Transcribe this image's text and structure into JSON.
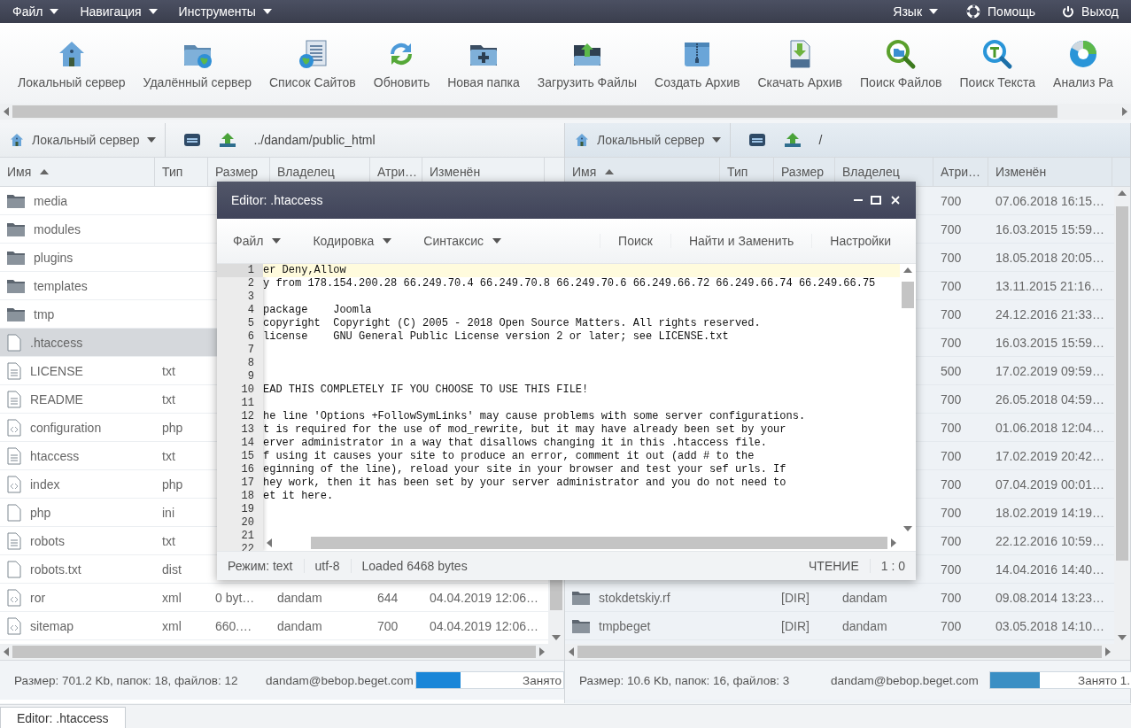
{
  "menubar": {
    "left": [
      {
        "label": "Файл"
      },
      {
        "label": "Навигация"
      },
      {
        "label": "Инструменты"
      }
    ],
    "language": {
      "label": "Язык"
    },
    "help": {
      "label": "Помощь"
    },
    "logout": {
      "label": "Выход"
    }
  },
  "toolbar": [
    {
      "label": "Локальный сервер"
    },
    {
      "label": "Удалённый сервер"
    },
    {
      "label": "Список Сайтов"
    },
    {
      "label": "Обновить"
    },
    {
      "label": "Новая папка"
    },
    {
      "label": "Загрузить Файлы"
    },
    {
      "label": "Создать Архив"
    },
    {
      "label": "Скачать Архив"
    },
    {
      "label": "Поиск Файлов"
    },
    {
      "label": "Поиск Текста"
    },
    {
      "label": "Анализ Ра"
    }
  ],
  "panels": [
    {
      "active": true,
      "server": "Локальный сервер",
      "path": "../dandam/public_html",
      "columns": [
        "Имя",
        "Тип",
        "Размер",
        "Владелец",
        "Атри…",
        "Изменён"
      ],
      "rows": [
        {
          "name": "media",
          "kind": "folder",
          "selected": false
        },
        {
          "name": "modules",
          "kind": "folder",
          "selected": false
        },
        {
          "name": "plugins",
          "kind": "folder",
          "selected": false
        },
        {
          "name": "templates",
          "kind": "folder",
          "selected": false
        },
        {
          "name": "tmp",
          "kind": "folder",
          "selected": false
        },
        {
          "name": ".htaccess",
          "kind": "blank",
          "selected": true
        },
        {
          "name": "LICENSE",
          "kind": "text",
          "type": "txt",
          "selected": false
        },
        {
          "name": "README",
          "kind": "text",
          "type": "txt",
          "selected": false
        },
        {
          "name": "configuration",
          "kind": "code",
          "type": "php",
          "selected": false
        },
        {
          "name": "htaccess",
          "kind": "text",
          "type": "txt",
          "selected": false
        },
        {
          "name": "index",
          "kind": "code",
          "type": "php",
          "selected": false
        },
        {
          "name": "php",
          "kind": "blank",
          "type": "ini",
          "selected": false
        },
        {
          "name": "robots",
          "kind": "text",
          "type": "txt",
          "selected": false
        },
        {
          "name": "robots.txt",
          "kind": "blank",
          "type": "dist",
          "selected": false
        },
        {
          "name": "ror",
          "kind": "code",
          "type": "xml",
          "size": "0 byt…",
          "owner": "dandam",
          "attributes": "644",
          "modified": "04.04.2019 12:06…",
          "selected": false
        },
        {
          "name": "sitemap",
          "kind": "code",
          "type": "xml",
          "size": "660.…",
          "owner": "dandam",
          "attributes": "700",
          "modified": "04.04.2019 12:06…",
          "selected": false
        }
      ],
      "status": "Размер: 701.2 Kb, папок: 18, файлов: 12",
      "account": "dandam@bebop.beget.com",
      "usage": {
        "label": "Занято",
        "level": 0.3
      }
    },
    {
      "active": false,
      "server": "Локальный сервер",
      "path": "/",
      "columns": [
        "Имя",
        "Тип",
        "Размер",
        "Владелец",
        "Атри…",
        "Изменён"
      ],
      "rows": [
        {
          "attributes": "700",
          "modified": "07.06.2018 16:15…",
          "selected": false
        },
        {
          "attributes": "700",
          "modified": "16.03.2015 15:59…",
          "selected": false
        },
        {
          "attributes": "700",
          "modified": "18.05.2018 20:05…",
          "selected": false
        },
        {
          "attributes": "700",
          "modified": "13.11.2015 21:16…",
          "selected": false
        },
        {
          "attributes": "700",
          "modified": "24.12.2016 21:33…",
          "selected": false
        },
        {
          "attributes": "700",
          "modified": "16.03.2015 15:59…",
          "selected": false
        },
        {
          "attributes": "500",
          "modified": "17.02.2019 09:59…",
          "selected": false
        },
        {
          "attributes": "700",
          "modified": "26.05.2018 04:59…",
          "selected": false
        },
        {
          "attributes": "700",
          "modified": "01.06.2018 12:04…",
          "selected": false
        },
        {
          "attributes": "700",
          "modified": "17.02.2019 20:42…",
          "selected": false
        },
        {
          "attributes": "700",
          "modified": "07.04.2019 00:01…",
          "selected": false
        },
        {
          "attributes": "700",
          "modified": "18.02.2019 14:19…",
          "selected": false
        },
        {
          "attributes": "700",
          "modified": "22.12.2016 10:59…",
          "selected": false
        },
        {
          "attributes": "700",
          "modified": "14.04.2016 14:40…",
          "selected": false
        },
        {
          "name": "stokdetskiy.rf",
          "kind": "folder",
          "size": "[DIR]",
          "owner": "dandam",
          "attributes": "700",
          "modified": "09.08.2014 13:23…",
          "selected": false
        },
        {
          "name": "tmpbeget",
          "kind": "folder",
          "size": "[DIR]",
          "owner": "dandam",
          "attributes": "700",
          "modified": "03.05.2018 14:10…",
          "selected": false
        }
      ],
      "status": "Размер: 10.6 Kb, папок: 16, файлов: 3",
      "account": "dandam@bebop.beget.com",
      "usage": {
        "label": "Занято 1.",
        "level": 0.35
      }
    }
  ],
  "editor": {
    "title": "Editor: .htaccess",
    "menus": [
      {
        "label": "Файл"
      },
      {
        "label": "Кодировка"
      },
      {
        "label": "Синтаксис"
      }
    ],
    "actions": [
      {
        "label": "Поиск"
      },
      {
        "label": "Найти и Заменить"
      },
      {
        "label": "Настройки"
      }
    ],
    "lines": [
      {
        "number": "1",
        "text": "er Deny,Allow",
        "current": true
      },
      {
        "number": "2",
        "text": "y from 178.154.200.28 66.249.70.4 66.249.70.8 66.249.70.6 66.249.66.72 66.249.66.74 66.249.66.75",
        "current": false
      },
      {
        "number": "3",
        "current": false
      },
      {
        "number": "4",
        "text": "package    Joomla",
        "current": false
      },
      {
        "number": "5",
        "text": "copyright  Copyright (C) 2005 - 2018 Open Source Matters. All rights reserved.",
        "current": false
      },
      {
        "number": "6",
        "text": "license    GNU General Public License version 2 or later; see LICENSE.txt",
        "current": false
      },
      {
        "number": "7",
        "current": false
      },
      {
        "number": "8",
        "current": false
      },
      {
        "number": "9",
        "current": false
      },
      {
        "number": "10",
        "text": "EAD THIS COMPLETELY IF YOU CHOOSE TO USE THIS FILE!",
        "current": false
      },
      {
        "number": "11",
        "current": false
      },
      {
        "number": "12",
        "text": "he line 'Options +FollowSymLinks' may cause problems with some server configurations.",
        "current": false
      },
      {
        "number": "13",
        "text": "t is required for the use of mod_rewrite, but it may have already been set by your",
        "current": false
      },
      {
        "number": "14",
        "text": "erver administrator in a way that disallows changing it in this .htaccess file.",
        "current": false
      },
      {
        "number": "15",
        "text": "f using it causes your site to produce an error, comment it out (add # to the",
        "current": false
      },
      {
        "number": "16",
        "text": "eginning of the line), reload your site in your browser and test your sef urls. If",
        "current": false
      },
      {
        "number": "17",
        "text": "hey work, then it has been set by your server administrator and you do not need to",
        "current": false
      },
      {
        "number": "18",
        "text": "et it here.",
        "current": false
      },
      {
        "number": "19",
        "current": false
      },
      {
        "number": "20",
        "current": false
      },
      {
        "number": "21",
        "current": false
      },
      {
        "number": "22",
        "current": false
      }
    ],
    "mode": "Режим: text",
    "encoding": "utf-8",
    "loaded": "Loaded 6468 bytes",
    "state": "ЧТЕНИЕ",
    "cursor": "1 : 0"
  },
  "taskbar": [
    {
      "label": "Editor: .htaccess",
      "selected": true
    }
  ]
}
